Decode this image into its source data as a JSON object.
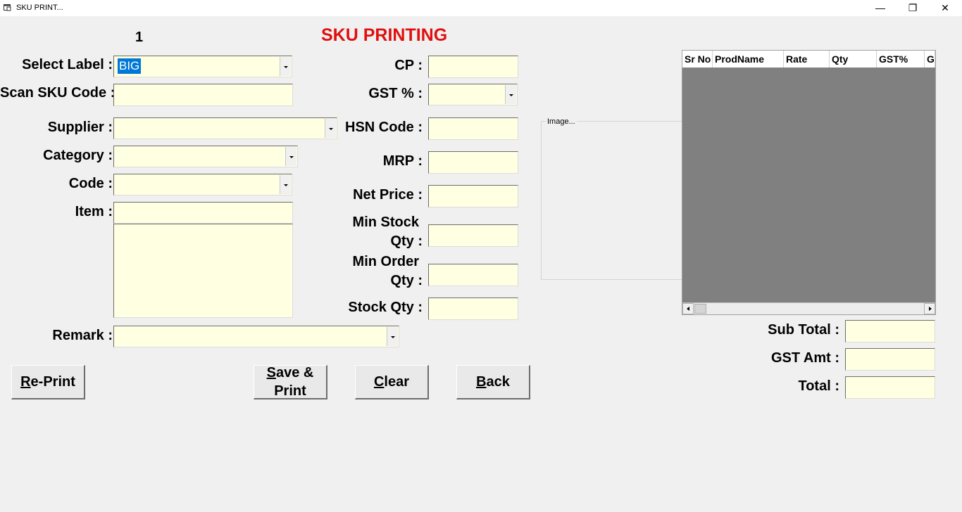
{
  "window": {
    "title": "SKU PRINT...",
    "minimize": "—",
    "maximize": "❐",
    "close": "✕"
  },
  "counter": "1",
  "heading": "SKU PRINTING",
  "labels": {
    "select_label": "Select Label :",
    "scan_sku": "Scan SKU Code :",
    "supplier": "Supplier :",
    "category": "Category :",
    "code": "Code :",
    "item": "Item :",
    "remark": "Remark :",
    "cp": "CP :",
    "gst": "GST % :",
    "hsn": "HSN Code :",
    "mrp": "MRP :",
    "net_price": "Net Price :",
    "min_stock_1": "Min Stock",
    "min_stock_2": "Qty :",
    "min_order_1": "Min Order",
    "min_order_2": "Qty :",
    "stock_qty": "Stock Qty :",
    "sub_total": "Sub Total :",
    "gst_amt": "GST Amt :",
    "total": "Total :"
  },
  "select_label_value": "BIG",
  "image_group": "Image...",
  "grid": {
    "columns": [
      "Sr No",
      "ProdName",
      "Rate",
      "Qty",
      "GST%",
      "GS"
    ]
  },
  "buttons": {
    "reprint_a": "R",
    "reprint_b": "e-Print",
    "save_a": "S",
    "save_b": "ave &",
    "save_c": "Print",
    "clear_a": "C",
    "clear_b": "lear",
    "back_a": "B",
    "back_b": "ack"
  },
  "icons": {
    "app": "window-icon",
    "scroll_left": "arrow-left-icon",
    "scroll_right": "arrow-right-icon",
    "dropdown": "chevron-down-icon"
  }
}
